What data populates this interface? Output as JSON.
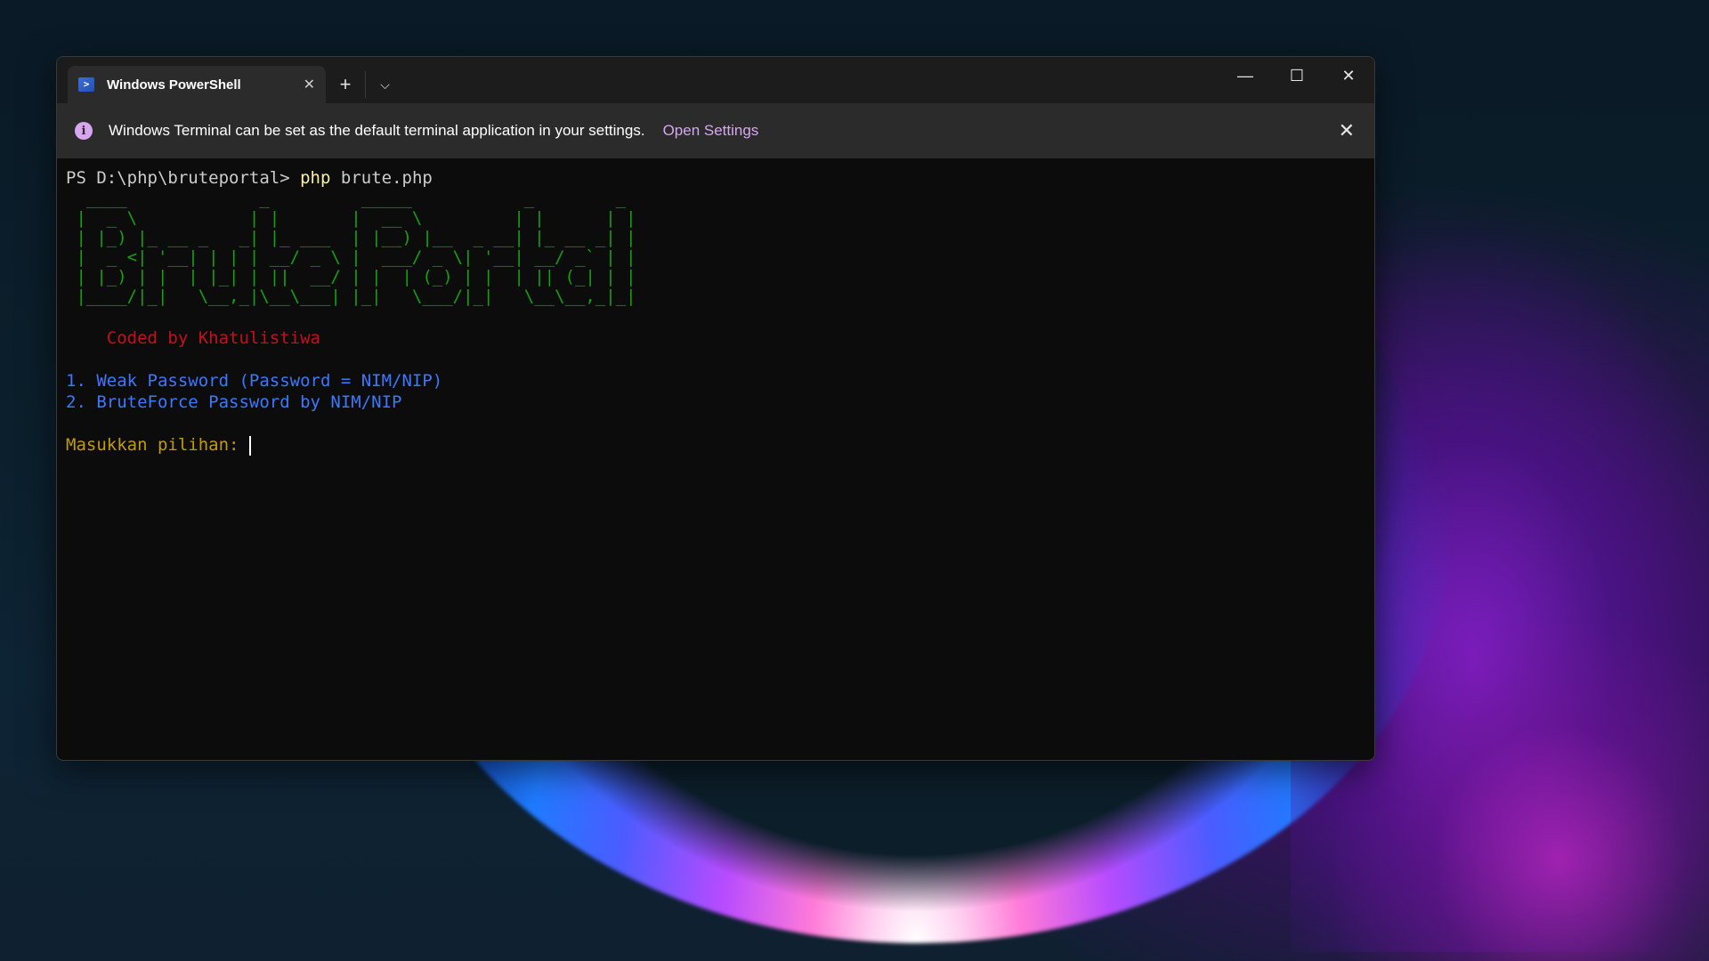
{
  "terminal": {
    "tab_title": "Windows PowerShell",
    "tab_icon": "powershell-icon",
    "tab_close": "✕",
    "new_tab": "+",
    "dropdown": "⌵",
    "controls": {
      "minimize": "—",
      "maximize": "☐",
      "close": "✕"
    }
  },
  "infobar": {
    "message": "Windows Terminal can be set as the default terminal application in your settings.",
    "link": "Open Settings",
    "close": "✕",
    "icon": "i"
  },
  "console": {
    "prompt": "PS D:\\php\\bruteportal> ",
    "command": "php",
    "argument": " brute.php",
    "ascii_art": [
      "  ____             _         _____           _        _ ",
      " |  _ \\           | |       |  __ \\         | |      | |",
      " | |_) |_ __ _   _| |_ ___  | |__) |__  _ __| |_ __ _| |",
      " |  _ <| '__| | | | __/ _ \\ |  ___/ _ \\| '__| __/ _` | |",
      " | |_) | |  | |_| | ||  __/ | |  | (_) | |  | || (_| | |",
      " |____/|_|   \\__,_|\\__\\___| |_|   \\___/|_|   \\__\\__,_|_|"
    ],
    "coded_by": "    Coded by Khatulistiwa",
    "menu": [
      "1. Weak Password (Password = NIM/NIP)",
      "2. BruteForce Password by NIM/NIP"
    ],
    "input_prompt": "Masukkan pilihan: "
  }
}
